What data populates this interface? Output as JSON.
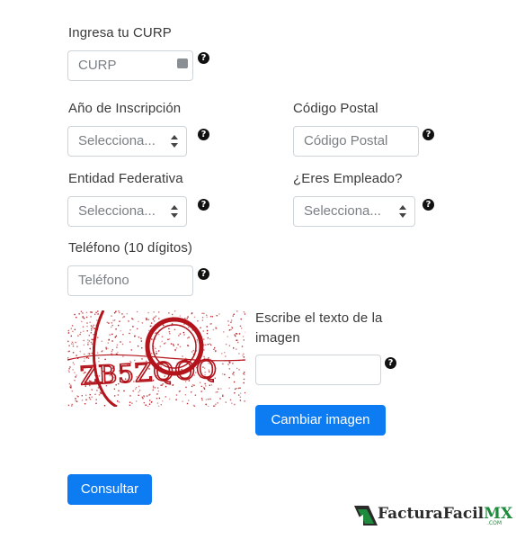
{
  "curp": {
    "label": "Ingresa tu CURP",
    "placeholder": "CURP"
  },
  "anio": {
    "label": "Año de Inscripción",
    "selected": "Selecciona..."
  },
  "cp": {
    "label": "Código Postal",
    "placeholder": "Código Postal"
  },
  "entidad": {
    "label": "Entidad Federativa",
    "selected": "Selecciona..."
  },
  "empleado": {
    "label": "¿Eres Empleado?",
    "selected": "Selecciona..."
  },
  "telefono": {
    "label": "Teléfono (10 dígitos)",
    "placeholder": "Teléfono"
  },
  "captcha": {
    "text": "ZB5ZQOQ",
    "label": "Escribe el texto de la imagen",
    "input_value": "",
    "change_button": "Cambiar imagen"
  },
  "submit_button": "Consultar",
  "help_glyph": "?",
  "logo": {
    "brand": "FacturaFacil",
    "suffix": "MX",
    "tld": ".COM"
  },
  "colors": {
    "primary": "#0d7cf2",
    "captcha": "#b3131b",
    "logo_green": "#1e8a3c"
  }
}
